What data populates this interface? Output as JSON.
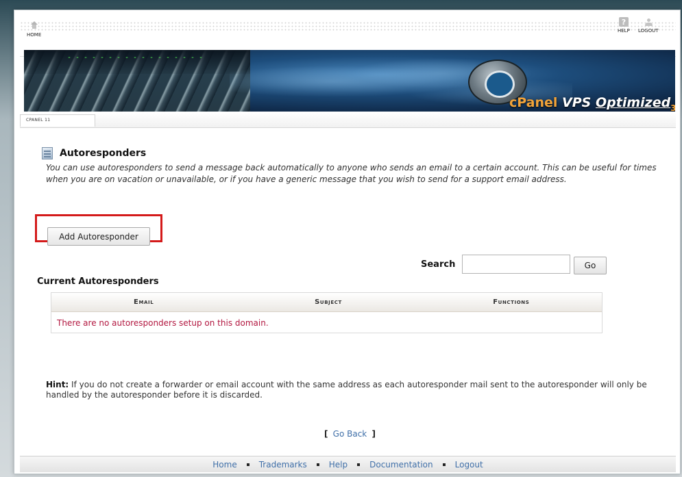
{
  "nav": {
    "home_label": "HOME",
    "help_label": "HELP",
    "logout_label": "LOGOUT"
  },
  "banner": {
    "brand_cp": "cPanel",
    "brand_rest": " VPS ",
    "brand_optimized": "Optimized",
    "brand_sub": "3"
  },
  "breadcrumb": {
    "label": "CPANEL 11"
  },
  "page": {
    "title": "Autoresponders",
    "description": "You can use autoresponders to send a message back automatically to anyone who sends an email to a certain account. This can be useful for times when you are on vacation or unavailable, or if you have a generic message that you wish to send for a support email address.",
    "add_button": "Add Autoresponder",
    "search_label": "Search",
    "search_value": "",
    "go_button": "Go",
    "section_title": "Current Autoresponders"
  },
  "table": {
    "columns": [
      "Email",
      "Subject",
      "Functions"
    ],
    "empty_message": "There are no autoresponders setup on this domain."
  },
  "hint": {
    "prefix": "Hint:",
    "text": " If you do not create a forwarder or email account with the same address as each autoresponder mail sent to the autoresponder will only be handled by the autoresponder before it is discarded."
  },
  "go_back": {
    "open": "[",
    "label": "Go Back",
    "close": "]"
  },
  "footer": {
    "links": [
      "Home",
      "Trademarks",
      "Help",
      "Documentation",
      "Logout"
    ]
  },
  "colors": {
    "highlight": "#d41a1a",
    "link": "#3f6fa8",
    "empty_text": "#b2163f"
  }
}
